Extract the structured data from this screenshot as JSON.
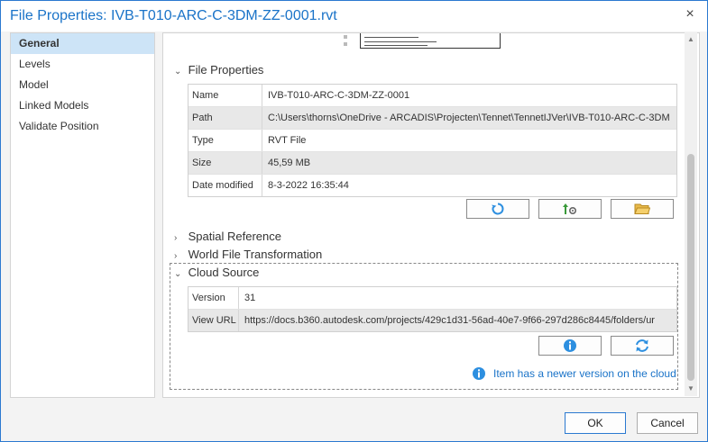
{
  "window": {
    "title": "File Properties: IVB-T010-ARC-C-3DM-ZZ-0001.rvt",
    "close": "×"
  },
  "nav": {
    "items": [
      "General",
      "Levels",
      "Model",
      "Linked Models",
      "Validate Position"
    ],
    "selected": "General"
  },
  "file_properties": {
    "header": "File Properties",
    "rows": [
      {
        "key": "Name",
        "value": "IVB-T010-ARC-C-3DM-ZZ-0001"
      },
      {
        "key": "Path",
        "value": "C:\\Users\\thorns\\OneDrive - ARCADIS\\Projecten\\Tennet\\TennetIJVer\\IVB-T010-ARC-C-3DM"
      },
      {
        "key": "Type",
        "value": "RVT File"
      },
      {
        "key": "Size",
        "value": "45,59 MB"
      },
      {
        "key": "Date modified",
        "value": "8-3-2022 16:35:44"
      }
    ],
    "buttons": [
      "refresh-icon",
      "upload-settings-icon",
      "folder-icon"
    ]
  },
  "collapsed_sections": [
    "Spatial Reference",
    "World File Transformation"
  ],
  "cloud_source": {
    "header": "Cloud Source",
    "rows": [
      {
        "key": "Version",
        "value": "31"
      },
      {
        "key": "View URL",
        "value": "https://docs.b360.autodesk.com/projects/429c1d31-56ad-40e7-9f66-297d286c8445/folders/ur"
      }
    ],
    "buttons": [
      "info-icon",
      "sync-icon"
    ],
    "notice": "Item has a newer version on the cloud"
  },
  "footer": {
    "ok": "OK",
    "cancel": "Cancel"
  },
  "colors": {
    "accent": "#1a73c8",
    "icon_blue": "#2d8fe0",
    "folder": "#e8b94a"
  }
}
